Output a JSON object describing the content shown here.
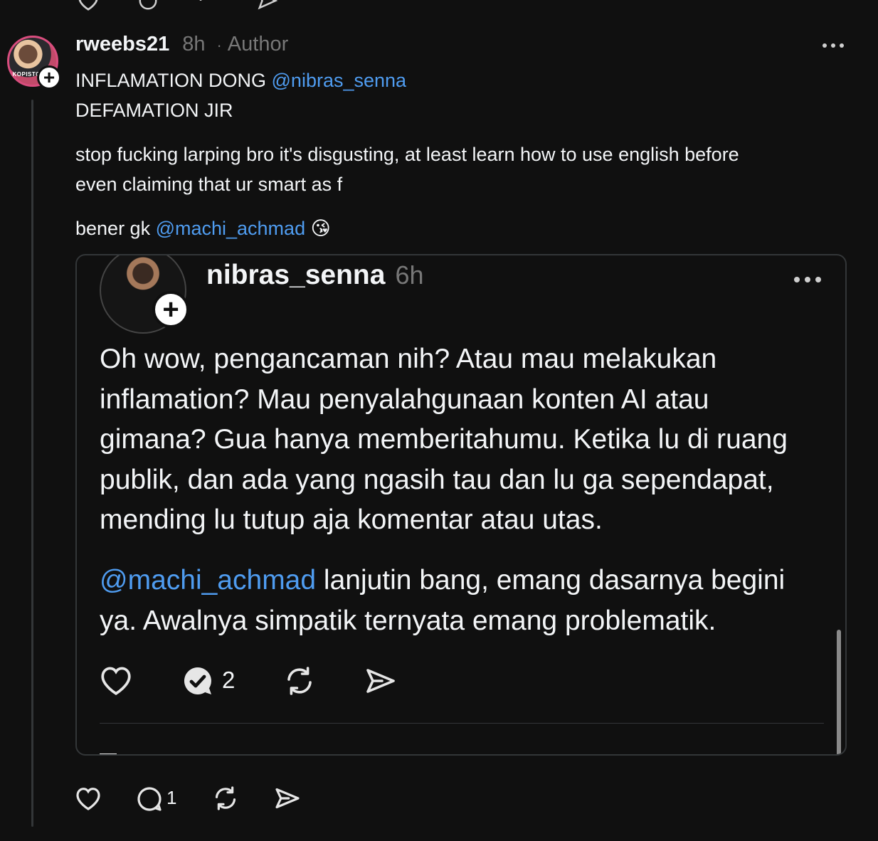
{
  "post": {
    "username": "rweebs21",
    "time": "8h",
    "separator": "·",
    "author_badge": "Author",
    "lines": [
      {
        "text": "INFLAMATION DONG ",
        "mention": "@nibras_senna"
      },
      {
        "text": "DEFAMATION JIR",
        "mention": ""
      },
      {
        "text": "stop fucking larping bro it's disgusting, at least learn how to use english before",
        "mention": ""
      },
      {
        "text": "even claiming that ur smart as f",
        "mention": ""
      },
      {
        "text": "bener gk ",
        "mention": "@machi_achmad",
        "emoji": "😘"
      }
    ],
    "reply_count": "1",
    "avatar_caption": "KOPISTODAY"
  },
  "quote": {
    "username": "nibras_senna",
    "time": "6h",
    "paragraph1": [
      "Oh wow, pengancaman nih? Atau mau melakukan",
      "inflamation? Mau penyalahgunaan konten AI atau",
      "gimana? Gua hanya memberitahumu. Ketika lu di ruang",
      "publik, dan ada yang ngasih tau dan lu ga sependapat,",
      "mending lu tutup aja komentar atau utas."
    ],
    "paragraph2_mention": "@machi_achmad",
    "paragraph2_line1_rest": " lanjutin bang, emang dasarnya begini",
    "paragraph2_line2": "ya. Awalnya simpatik ternyata emang problematik.",
    "reply_count": "2"
  },
  "icons": {
    "like": "heart-icon",
    "reply": "comment-icon",
    "repost": "repost-icon",
    "share": "send-icon",
    "more": "more-icon",
    "follow": "plus-icon"
  },
  "colors": {
    "background": "#101010",
    "text": "#f3f5f7",
    "muted": "#777777",
    "mention": "#4f9cf0",
    "border": "#333638"
  }
}
